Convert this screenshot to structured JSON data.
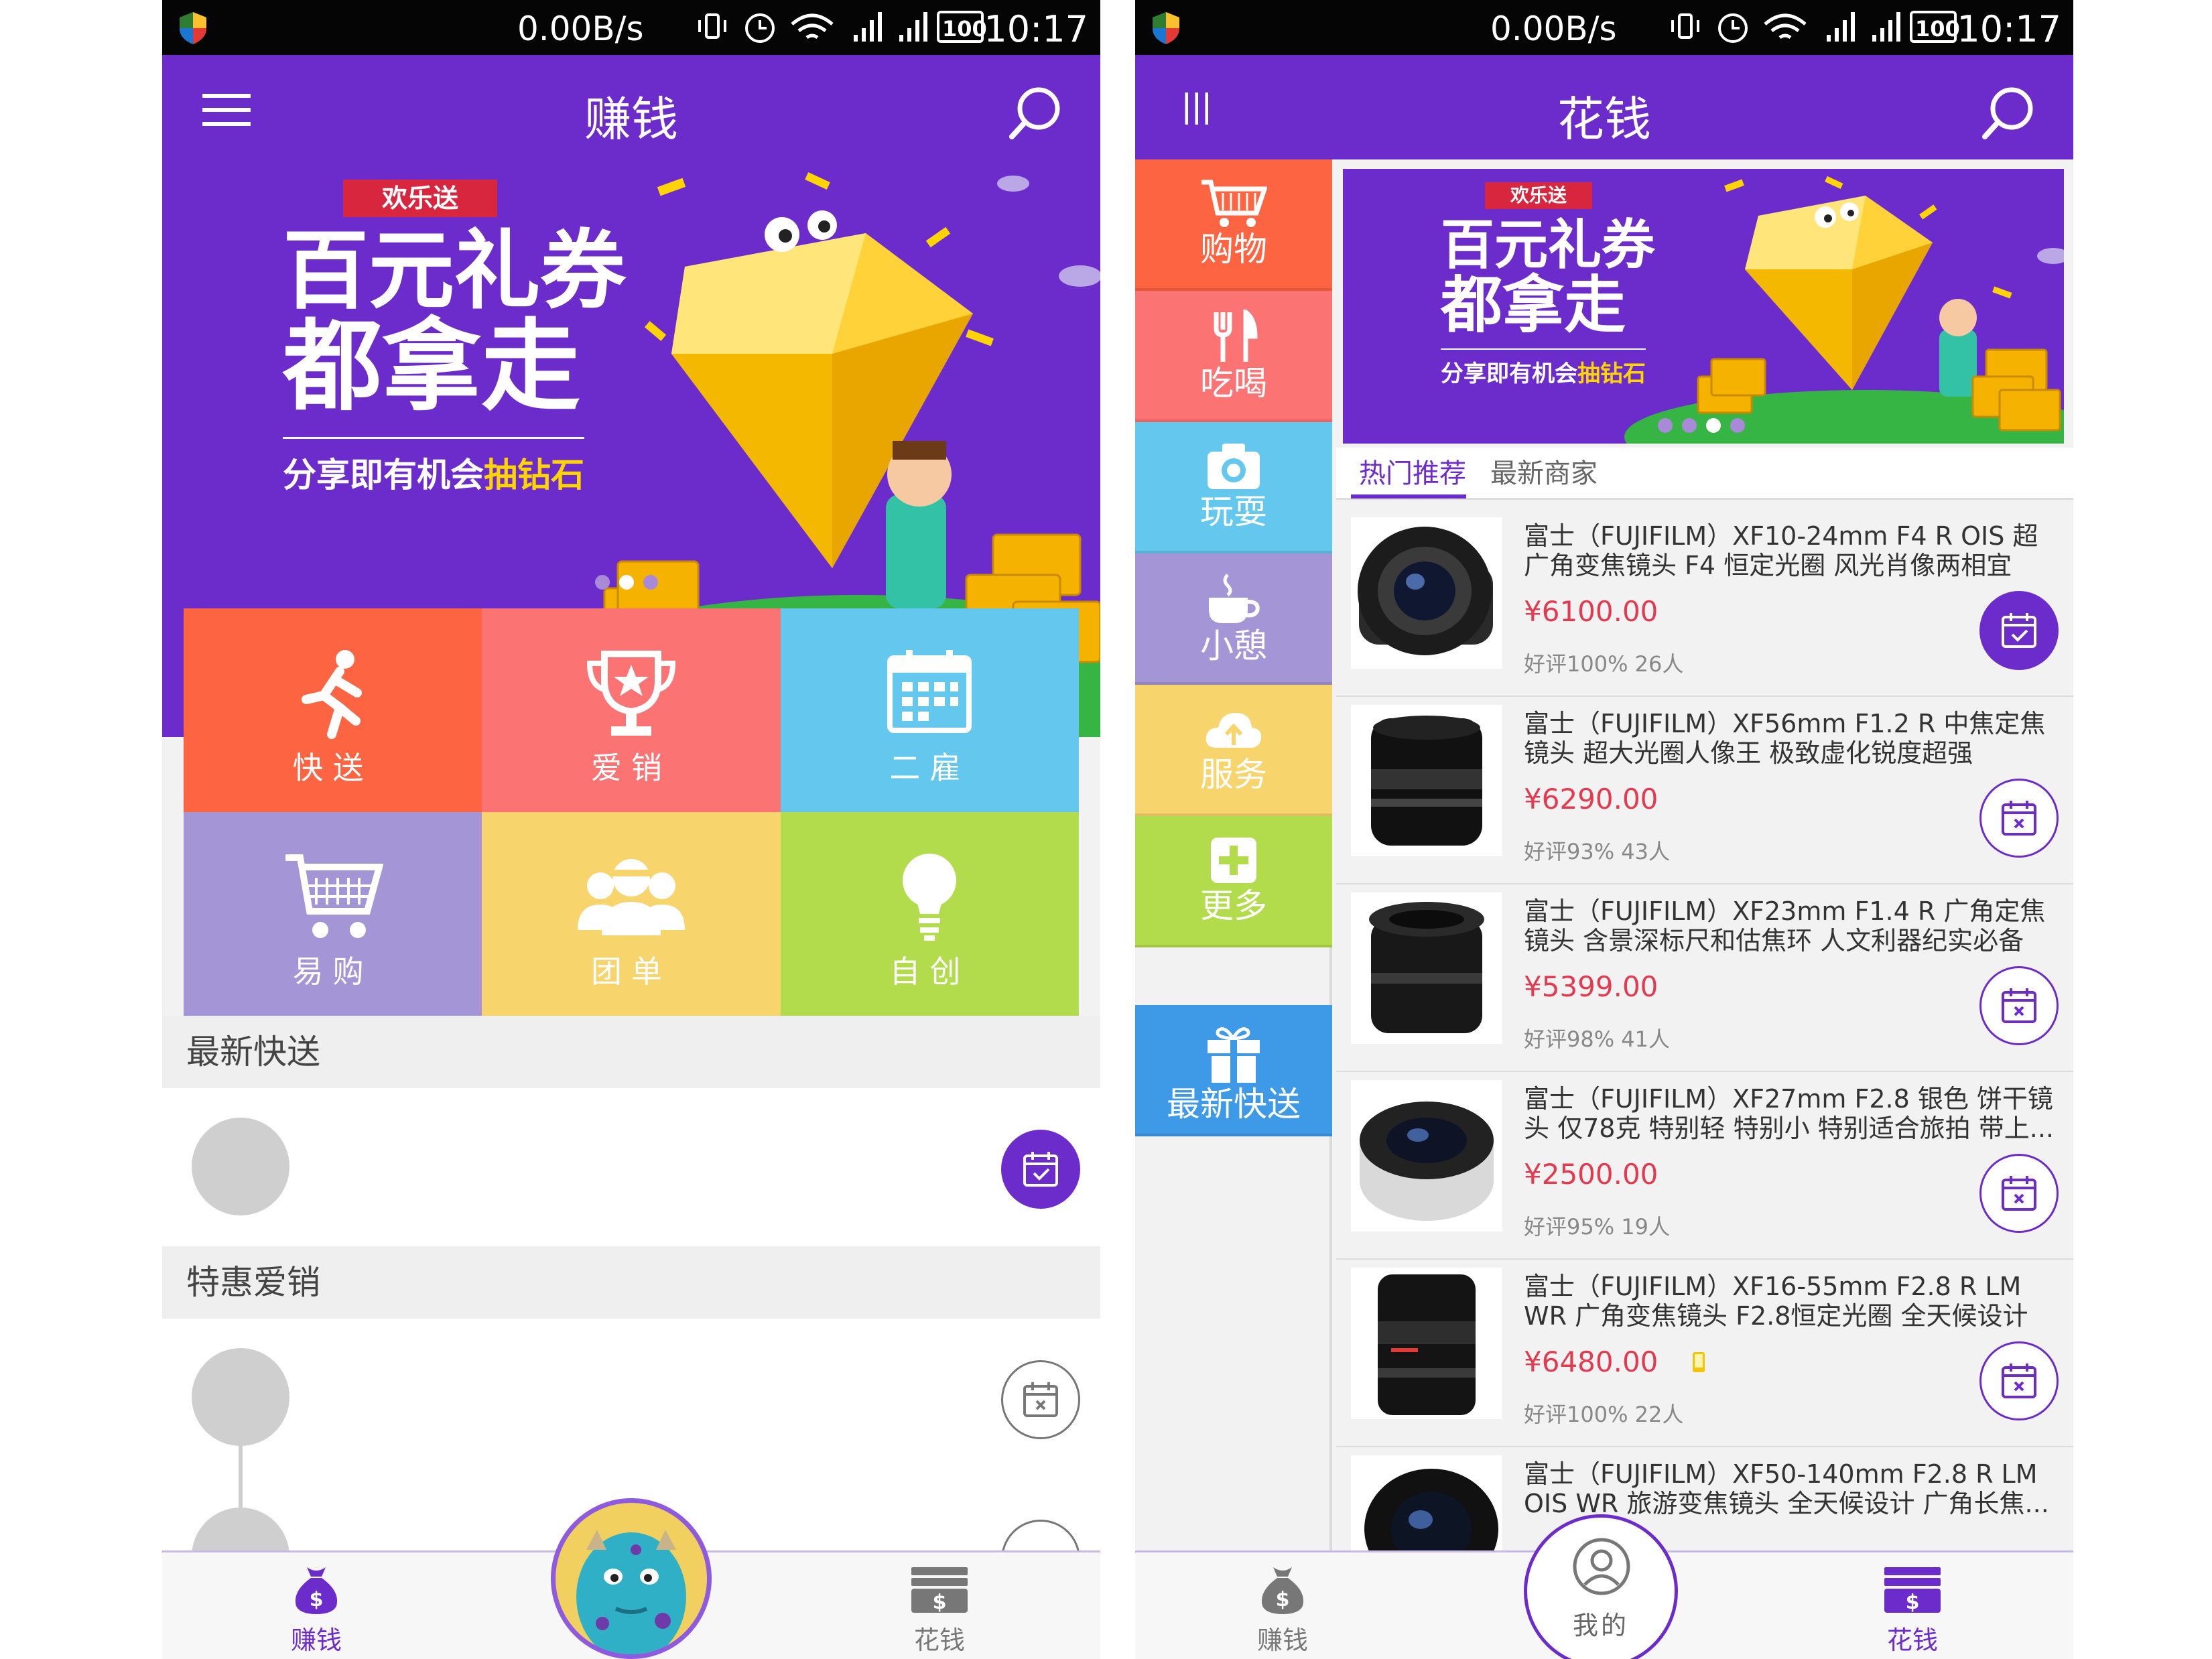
{
  "colors": {
    "brand_purple": "#6c2ccb",
    "price_red": "#e43a4f",
    "tile_orange": "#fd6441",
    "tile_pink": "#fb7373",
    "tile_blue": "#63c7ee",
    "tile_lavender": "#a496d6",
    "tile_yellow": "#f8d46d",
    "tile_green": "#b2dc4b",
    "cat_blue": "#3e9ae6"
  },
  "status_bar": {
    "speed": "0.00B/s",
    "battery": "100",
    "time": "10:17"
  },
  "left_screen": {
    "header": {
      "title": "赚钱",
      "menu_icon": "hamburger-icon",
      "search_icon": "search-icon"
    },
    "banner": {
      "ribbon": "欢乐送",
      "headline_line1": "百元礼券",
      "headline_line2": "都拿走",
      "subline_prefix": "分享即有机会",
      "subline_highlight": "抽钻石",
      "page_count": 3,
      "active_page": 2
    },
    "tiles": [
      {
        "label": "快送",
        "icon": "running-person-icon",
        "color": "#fd6441"
      },
      {
        "label": "爱销",
        "icon": "trophy-icon",
        "color": "#fb7373"
      },
      {
        "label": "二雇",
        "icon": "calendar-grid-icon",
        "color": "#63c7ee"
      },
      {
        "label": "易购",
        "icon": "shopping-cart-icon",
        "color": "#a496d6"
      },
      {
        "label": "团单",
        "icon": "group-icon",
        "color": "#f8d46d"
      },
      {
        "label": "自创",
        "icon": "lightbulb-icon",
        "color": "#b2dc4b"
      }
    ],
    "sections": [
      {
        "title": "最新快送"
      },
      {
        "title": "特惠爱销"
      }
    ],
    "bottom_nav": {
      "earn_label": "赚钱",
      "spend_label": "花钱"
    }
  },
  "right_screen": {
    "header": {
      "title": "花钱",
      "menu_icon": "vertical-bars-icon",
      "search_icon": "search-icon"
    },
    "categories": [
      {
        "label": "购物",
        "icon": "cart-icon",
        "color": "#fd6441"
      },
      {
        "label": "吃喝",
        "icon": "fork-knife-icon",
        "color": "#fb7373"
      },
      {
        "label": "玩耍",
        "icon": "camera-icon",
        "color": "#63c7ee"
      },
      {
        "label": "小憩",
        "icon": "coffee-cup-icon",
        "color": "#a496d6"
      },
      {
        "label": "服务",
        "icon": "cloud-icon",
        "color": "#f8d46d"
      },
      {
        "label": "更多",
        "icon": "plus-icon",
        "color": "#b2dc4b"
      }
    ],
    "latest_button": {
      "label": "最新快送",
      "icon": "gift-icon"
    },
    "banner": {
      "ribbon": "欢乐送",
      "headline_line1": "百元礼券",
      "headline_line2": "都拿走",
      "subline_prefix": "分享即有机会",
      "subline_highlight": "抽钻石",
      "page_count": 4,
      "active_page": 3
    },
    "tabs": [
      {
        "label": "热门推荐",
        "active": true
      },
      {
        "label": "最新商家",
        "active": false
      }
    ],
    "products": [
      {
        "name": "富士（FUJIFILM）XF10-24mm F4 R OIS 超广角变焦镜头 F4 恒定光圈 风光肖像两相宜",
        "price": "¥6100.00",
        "rating": "好评100% 26人",
        "action": "calendar-check-icon",
        "action_filled": true
      },
      {
        "name": "富士（FUJIFILM）XF56mm F1.2 R 中焦定焦镜头 超大光圈人像王 极致虚化锐度超强",
        "price": "¥6290.00",
        "rating": "好评93% 43人",
        "action": "calendar-x-icon",
        "action_filled": false
      },
      {
        "name": "富士（FUJIFILM）XF23mm F1.4 R 广角定焦镜头 含景深标尺和估焦环 人文利器纪实必备",
        "price": "¥5399.00",
        "rating": "好评98% 41人",
        "action": "calendar-x-icon",
        "action_filled": false
      },
      {
        "name": "富士（FUJIFILM）XF27mm F2.8 银色 饼干镜头 仅78克 特别轻 特别小 特别适合旅拍 带上...",
        "price": "¥2500.00",
        "rating": "好评95% 19人",
        "action": "calendar-x-icon",
        "action_filled": false
      },
      {
        "name": "富士（FUJIFILM）XF16-55mm F2.8 R LM WR 广角变焦镜头 F2.8恒定光圈 全天候设计 ...",
        "price": "¥6480.00",
        "rating": "好评100% 22人",
        "action": "calendar-x-icon",
        "action_filled": false
      },
      {
        "name": "富士（FUJIFILM）XF50-140mm F2.8 R LM OIS WR 旅游变焦镜头 全天候设计 广角长焦...",
        "price": "",
        "rating": "",
        "action": "",
        "action_filled": false
      }
    ],
    "bottom_nav": {
      "earn_label": "赚钱",
      "me_label": "我的",
      "spend_label": "花钱"
    }
  }
}
